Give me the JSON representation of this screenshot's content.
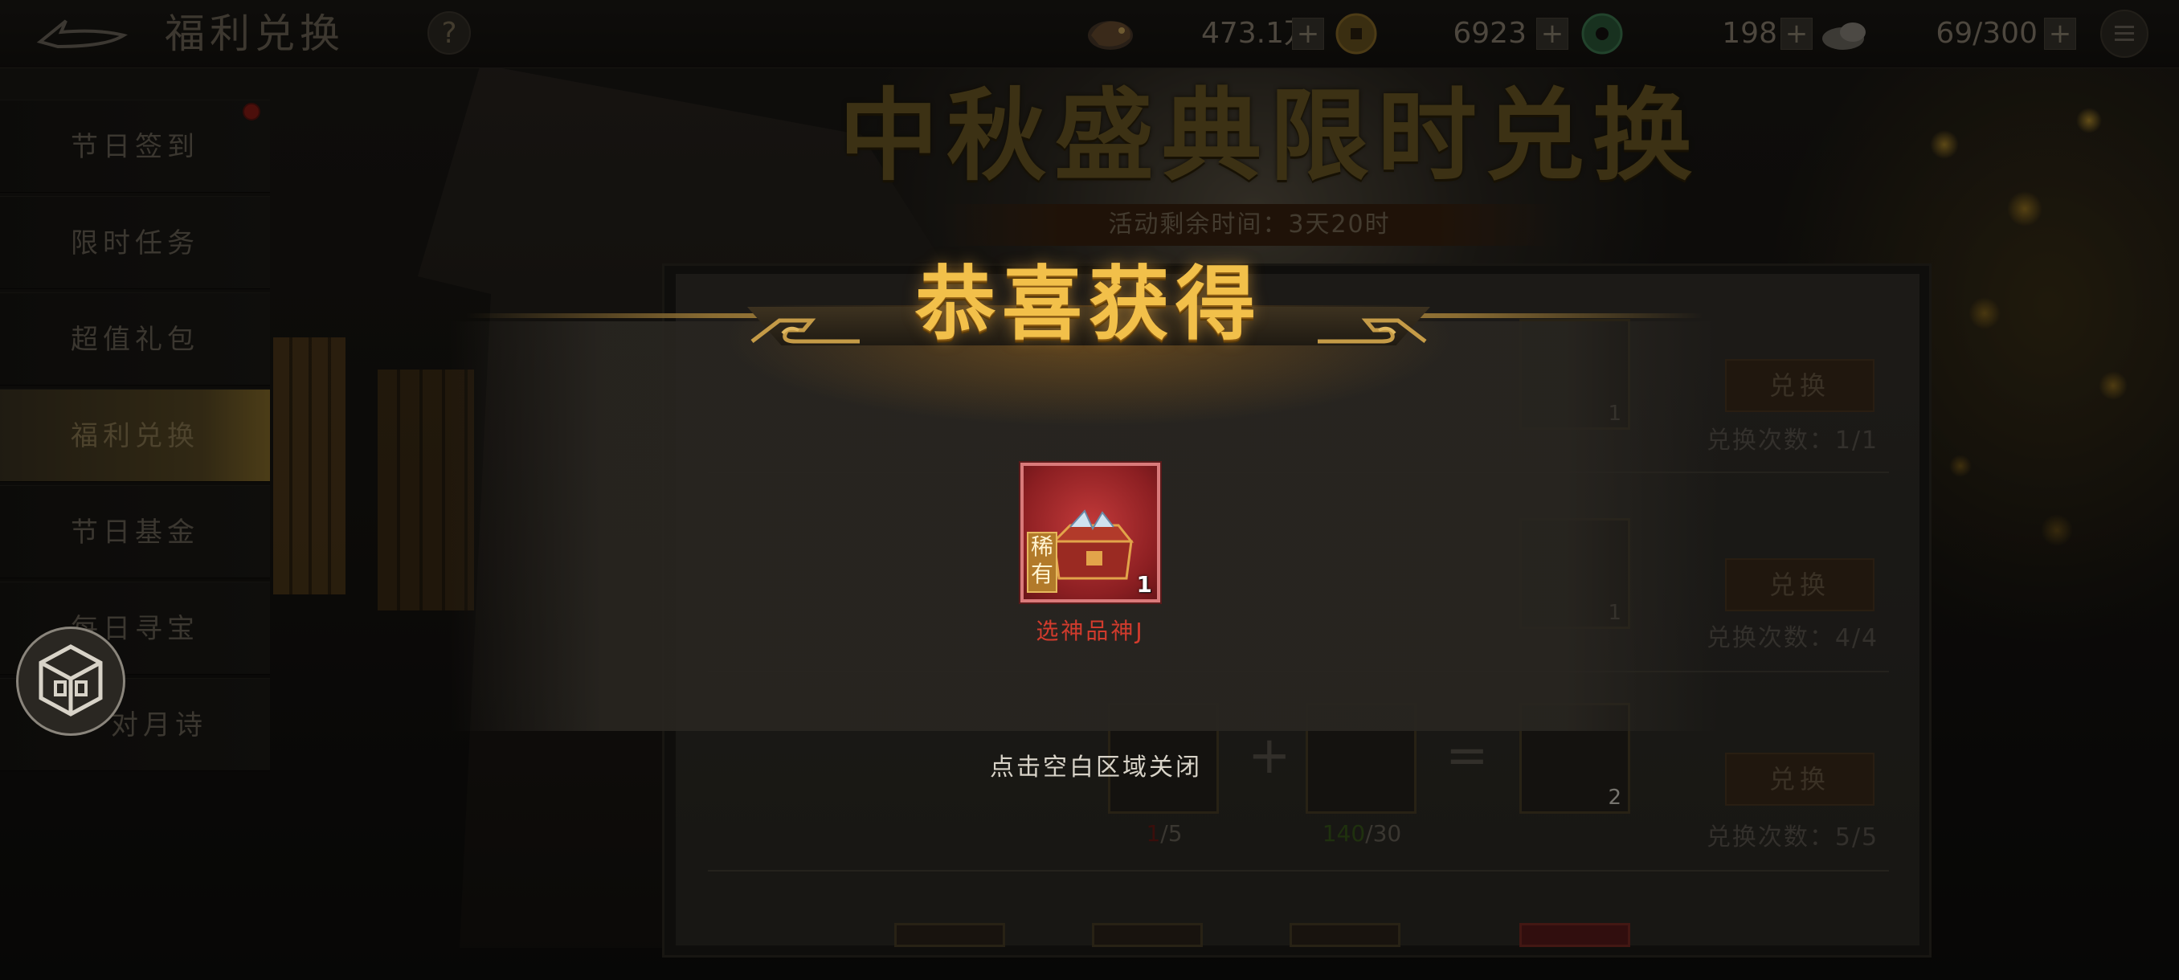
{
  "topbar": {
    "title": "福利兑换",
    "help": "?",
    "resources": [
      {
        "icon": "dragon-token-icon",
        "value": "473.1万"
      },
      {
        "icon": "gold-coin-icon",
        "value": "6923"
      },
      {
        "icon": "jade-icon",
        "value": "198"
      },
      {
        "icon": "stamina-cloud-icon",
        "value": "69/300"
      }
    ],
    "plus": "+"
  },
  "sidebar": {
    "items": [
      {
        "label": "节日签到"
      },
      {
        "label": "限时任务"
      },
      {
        "label": "超值礼包"
      },
      {
        "label": "福利兑换"
      },
      {
        "label": "节日基金"
      },
      {
        "label": "每日寻宝"
      },
      {
        "label": "对月诗"
      }
    ],
    "active_index": 3
  },
  "event": {
    "title": "中秋盛典限时兑换",
    "timer": "活动剩余时间：3天20时"
  },
  "exchange": {
    "button_label": "兑换",
    "rows": [
      {
        "count_text": "兑换次数：1/1",
        "result_count": "1"
      },
      {
        "count_text": "兑换次数：4/4",
        "result_count": "1"
      },
      {
        "count_text": "兑换次数：5/5",
        "result_count": "2",
        "progress_a_cur": "1",
        "progress_a_rest": "/5",
        "progress_b_cur": "140",
        "progress_b_rest": "/30"
      }
    ],
    "op_plus": "+",
    "op_equals": "="
  },
  "popup": {
    "title": "恭喜获得",
    "reward": {
      "name": "选神品神J",
      "count": "1",
      "rarity": "稀有"
    },
    "close_hint": "点击空白区域关闭"
  },
  "colors": {
    "gold_title": "#f2c04a",
    "reward_name_red": "#d23b2d",
    "rare_tag": "#b27a2a"
  }
}
